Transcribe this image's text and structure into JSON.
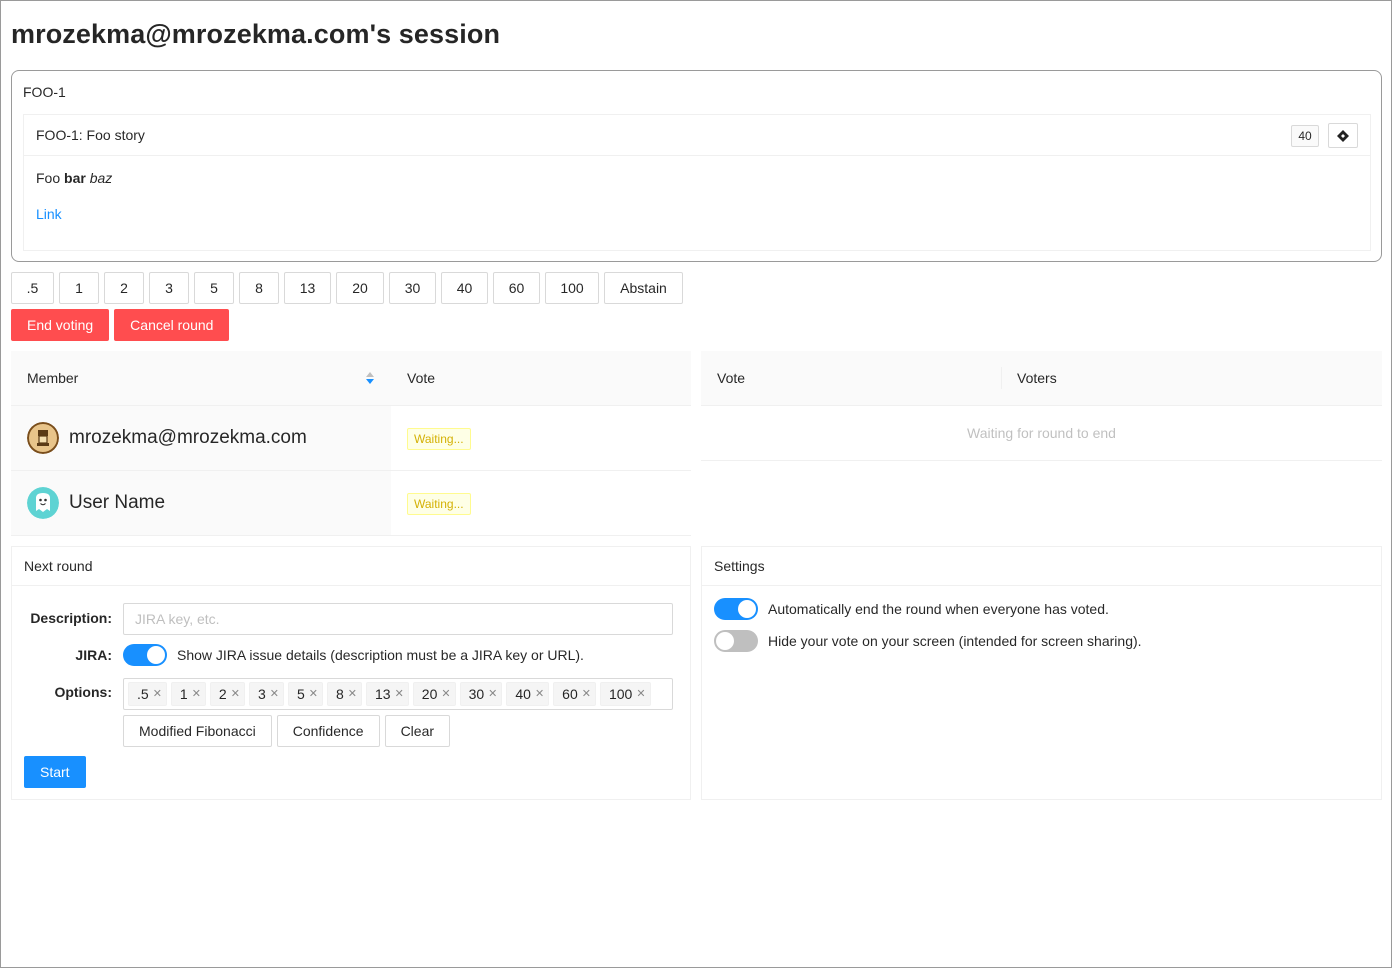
{
  "session_title": "mrozekma@mrozekma.com's session",
  "story": {
    "key": "FOO-1",
    "card_title": "FOO-1: Foo story",
    "points": "40",
    "desc_plain": "Foo ",
    "desc_bold": "bar",
    "desc_space": " ",
    "desc_italic": "baz",
    "link_label": "Link"
  },
  "vote_options": [
    ".5",
    "1",
    "2",
    "3",
    "5",
    "8",
    "13",
    "20",
    "30",
    "40",
    "60",
    "100",
    "Abstain"
  ],
  "actions": {
    "end_voting": "End voting",
    "cancel_round": "Cancel round"
  },
  "members_table": {
    "col_member": "Member",
    "col_vote": "Vote",
    "rows": [
      {
        "name": "mrozekma@mrozekma.com",
        "status": "Waiting..."
      },
      {
        "name": "User Name",
        "status": "Waiting..."
      }
    ]
  },
  "results_table": {
    "col_vote": "Vote",
    "col_voters": "Voters",
    "empty_text": "Waiting for round to end"
  },
  "next_round": {
    "title": "Next round",
    "description_label": "Description",
    "description_placeholder": "JIRA key, etc.",
    "description_value": "",
    "jira_label": "JIRA",
    "jira_switch_label": "Show JIRA issue details (description must be a JIRA key or URL).",
    "jira_enabled": true,
    "options_label": "Options",
    "options": [
      ".5",
      "1",
      "2",
      "3",
      "5",
      "8",
      "13",
      "20",
      "30",
      "40",
      "60",
      "100"
    ],
    "presets": [
      "Modified Fibonacci",
      "Confidence",
      "Clear"
    ],
    "start_label": "Start"
  },
  "settings": {
    "title": "Settings",
    "auto_end_label": "Automatically end the round when everyone has voted.",
    "auto_end_enabled": true,
    "hide_vote_label": "Hide your vote on your screen (intended for screen sharing).",
    "hide_vote_enabled": false
  },
  "colors": {
    "primary": "#1890ff",
    "danger": "#ff4d4f",
    "waiting_tag": "#d4b106"
  },
  "icons": {
    "jira_button": "jira-diamond-icon",
    "sort": "sort-icon",
    "remove": "close-icon"
  }
}
